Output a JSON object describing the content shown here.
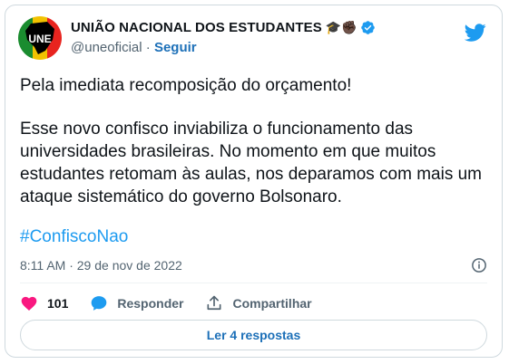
{
  "account": {
    "name": "UNIÃO NACIONAL DOS ESTUDANTES",
    "name_emoji": "🎓✊🏿",
    "handle": "@uneoficial",
    "separator": "·",
    "follow_label": "Seguir",
    "avatar_text": "UNE",
    "avatar_colors": [
      "#e8241f",
      "#f2c200",
      "#1a8c2f",
      "#000000"
    ]
  },
  "tweet": {
    "paragraph1": "Pela imediata recomposição do orçamento!",
    "paragraph2": "Esse novo confisco inviabiliza o funcionamento das universidades brasileiras. No momento em que muitos estudantes retomam às aulas, nos deparamos com mais um ataque sistemático do governo Bolsonaro.",
    "hashtag": "#ConfiscoNao",
    "timestamp": "8:11 AM · 29 de nov de 2022"
  },
  "actions": {
    "like_count": "101",
    "reply_label": "Responder",
    "share_label": "Compartilhar"
  },
  "replies_button": "Ler 4 respostas",
  "icons": {
    "brand": "twitter-bird-icon",
    "verified": "verified-badge-icon",
    "info": "info-icon",
    "like": "heart-icon",
    "reply": "speech-bubble-icon",
    "share": "share-icon"
  },
  "colors": {
    "accent": "#1d9bf0",
    "link": "#1d70b8",
    "like": "#f91880",
    "muted": "#536471"
  }
}
